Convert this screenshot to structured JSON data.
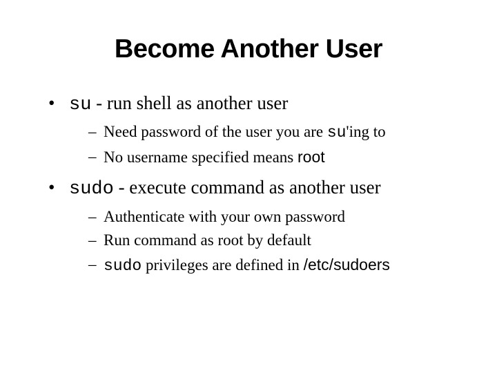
{
  "title": "Become Another User",
  "bullets": [
    {
      "cmd": "su",
      "desc": " - run shell as another user",
      "subs": [
        {
          "pre": "Need password of the user you are ",
          "code": "su",
          "post": "'ing to"
        },
        {
          "pre": "No username specified means ",
          "sans": "root",
          "post": ""
        }
      ]
    },
    {
      "cmd": "sudo",
      "desc": " - execute command as another user",
      "subs": [
        {
          "pre": "Authenticate with your own password",
          "post": ""
        },
        {
          "pre": "Run command as root by default",
          "post": ""
        },
        {
          "code_first": "sudo",
          "pre2": " privileges are defined in ",
          "sans": "/etc/sudoers",
          "post": ""
        }
      ]
    }
  ]
}
